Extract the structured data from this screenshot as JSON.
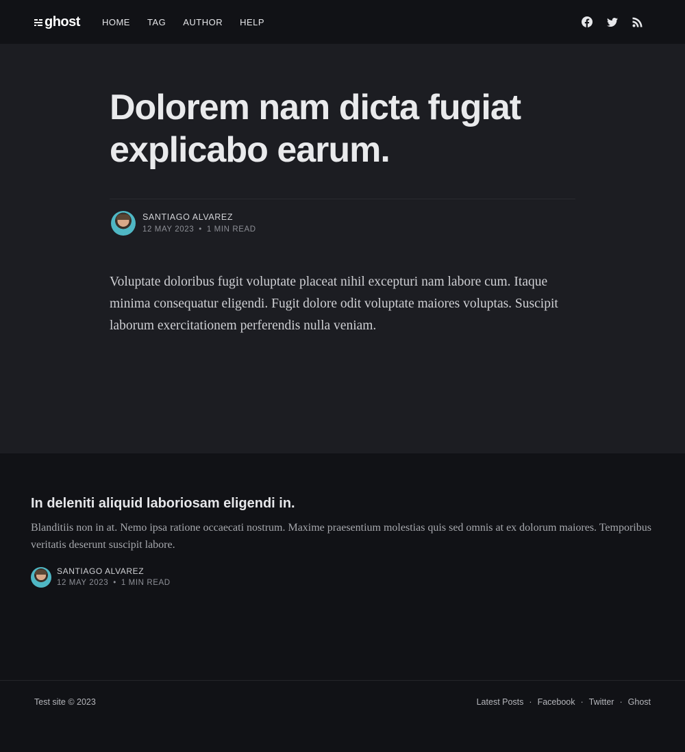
{
  "header": {
    "logo_text": "ghost",
    "nav": [
      {
        "label": "HOME"
      },
      {
        "label": "TAG"
      },
      {
        "label": "AUTHOR"
      },
      {
        "label": "HELP"
      }
    ],
    "social_icons": [
      "facebook-icon",
      "twitter-icon",
      "rss-icon"
    ]
  },
  "article": {
    "title": "Dolorem nam dicta fugiat explicabo earum.",
    "author": "SANTIAGO ALVAREZ",
    "date": "12 MAY 2023",
    "separator": "•",
    "read_time": "1 MIN READ",
    "body": "Voluptate doloribus fugit voluptate placeat nihil excepturi nam labore cum. Itaque minima consequatur eligendi. Fugit dolore odit voluptate maiores voluptas. Suscipit laborum exercitationem perferendis nulla veniam."
  },
  "related": {
    "title": "In deleniti aliquid laboriosam eligendi in.",
    "excerpt": "Blanditiis non in at. Nemo ipsa ratione occaecati nostrum. Maxime praesentium molestias quis sed omnis at ex dolorum maiores. Temporibus veritatis deserunt suscipit labore.",
    "author": "SANTIAGO ALVAREZ",
    "date": "12 MAY 2023",
    "separator": "•",
    "read_time": "1 MIN READ"
  },
  "footer": {
    "copyright": "Test site © 2023",
    "separator": "·",
    "links": [
      {
        "label": "Latest Posts"
      },
      {
        "label": "Facebook"
      },
      {
        "label": "Twitter"
      },
      {
        "label": "Ghost"
      }
    ]
  },
  "colors": {
    "header_bg": "#111216",
    "article_bg": "#1c1d22",
    "page_bg": "#111216",
    "text_primary": "#e9eaec",
    "text_muted": "#8d8f96"
  }
}
